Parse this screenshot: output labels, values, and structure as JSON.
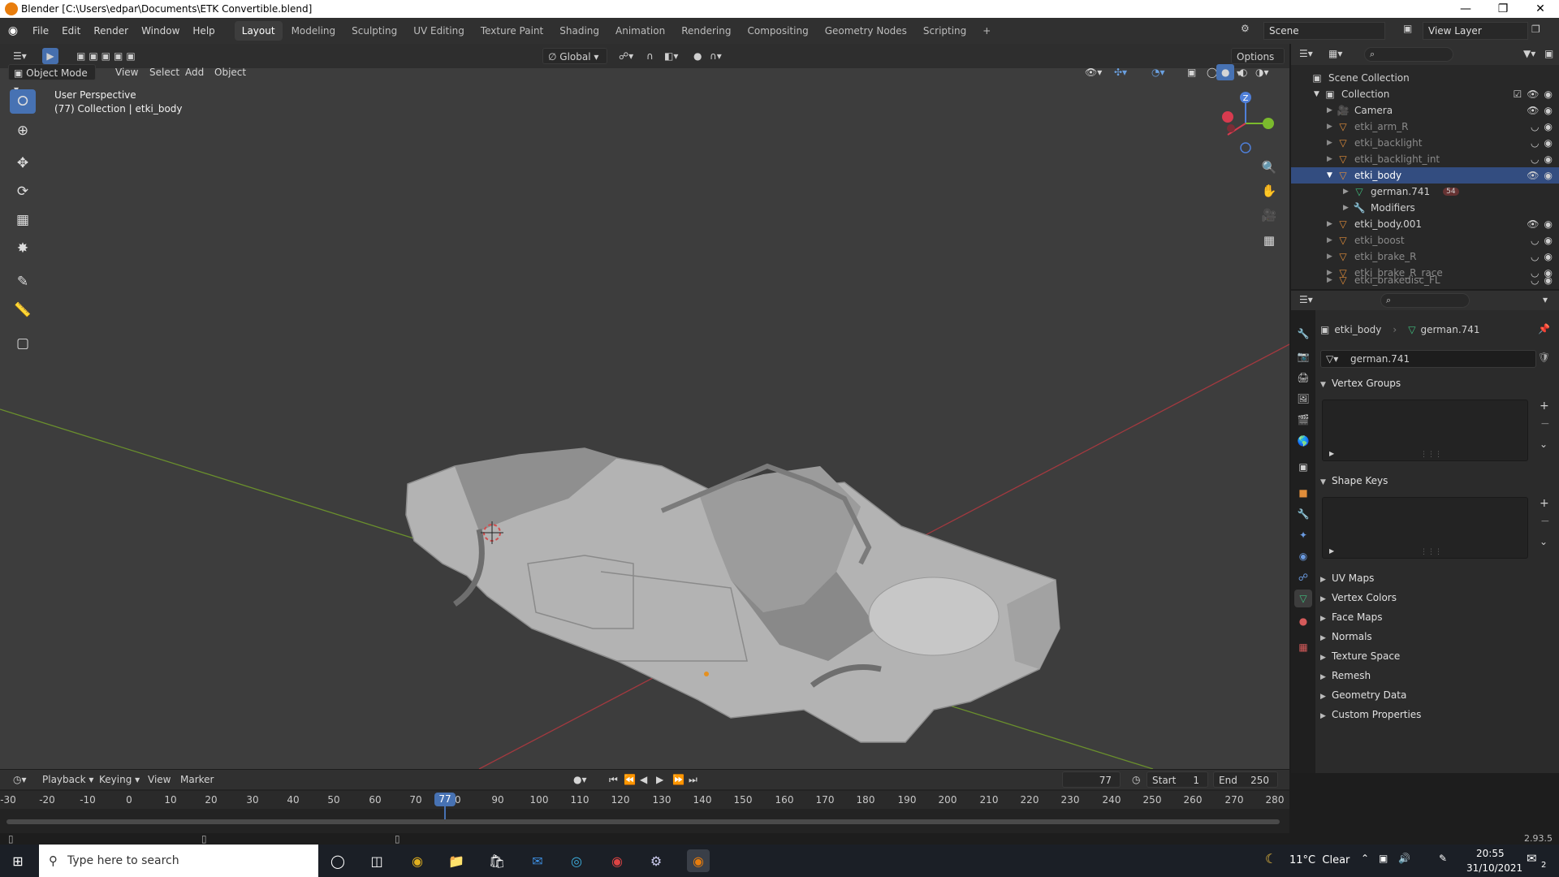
{
  "window": {
    "title": "Blender [C:\\Users\\edpar\\Documents\\ETK Convertible.blend]"
  },
  "menu": {
    "items": [
      "File",
      "Edit",
      "Render",
      "Window",
      "Help"
    ]
  },
  "workspaces": {
    "tabs": [
      "Layout",
      "Modeling",
      "Sculpting",
      "UV Editing",
      "Texture Paint",
      "Shading",
      "Animation",
      "Rendering",
      "Compositing",
      "Geometry Nodes",
      "Scripting"
    ],
    "active": "Layout"
  },
  "scene": {
    "name": "Scene",
    "view_layer": "View Layer"
  },
  "viewport": {
    "mode": "Object Mode",
    "menus": [
      "View",
      "Select",
      "Add",
      "Object"
    ],
    "orientation": "Global",
    "options_label": "Options",
    "overlay_line1": "User Perspective",
    "overlay_line2": "(77) Collection | etki_body",
    "gizmo_axis": "Z"
  },
  "outliner": {
    "root": "Scene Collection",
    "collection": "Collection",
    "items": [
      {
        "name": "Camera"
      },
      {
        "name": "etki_arm_R"
      },
      {
        "name": "etki_backlight"
      },
      {
        "name": "etki_backlight_int"
      },
      {
        "name": "etki_body"
      },
      {
        "name": "german.741"
      },
      {
        "name": "Modifiers"
      },
      {
        "name": "etki_body.001"
      },
      {
        "name": "etki_boost"
      },
      {
        "name": "etki_brake_R"
      },
      {
        "name": "etki_brake_R_race"
      },
      {
        "name": "etki_brakedisc_FL"
      }
    ],
    "material_badge": "54"
  },
  "properties": {
    "object": "etki_body",
    "mesh": "german.741",
    "mesh_field": "german.741",
    "panels": [
      "Vertex Groups",
      "Shape Keys",
      "UV Maps",
      "Vertex Colors",
      "Face Maps",
      "Normals",
      "Texture Space",
      "Remesh",
      "Geometry Data",
      "Custom Properties"
    ]
  },
  "timeline": {
    "menus": [
      "Playback",
      "Keying",
      "View",
      "Marker"
    ],
    "current_frame": "77",
    "start_label": "Start",
    "start": "1",
    "end_label": "End",
    "end": "250",
    "ticks": [
      "-30",
      "-20",
      "-10",
      "0",
      "10",
      "20",
      "30",
      "40",
      "50",
      "60",
      "70",
      "80",
      "90",
      "100",
      "110",
      "120",
      "130",
      "140",
      "150",
      "160",
      "170",
      "180",
      "190",
      "200",
      "210",
      "220",
      "230",
      "240",
      "250",
      "260",
      "270",
      "280"
    ]
  },
  "status": {
    "version": "2.93.5"
  },
  "taskbar": {
    "search_placeholder": "Type here to search",
    "weather": "11°C  Clear",
    "time": "20:55",
    "date": "31/10/2021",
    "notifications": "2"
  }
}
